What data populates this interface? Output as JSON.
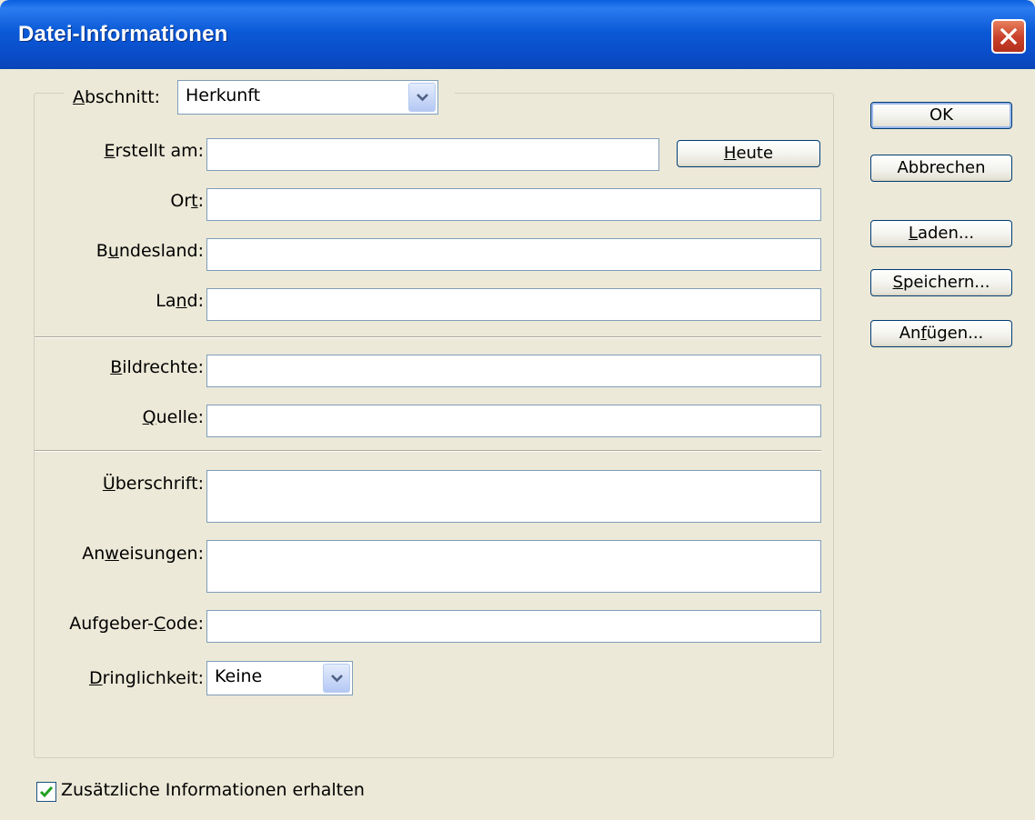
{
  "window": {
    "title": "Datei-Informationen",
    "close_icon": "close-icon"
  },
  "section": {
    "label_prefix": "A",
    "label_rest": "bschnitt:",
    "value": "Herkunft"
  },
  "fields": {
    "erstellt": {
      "label_u": "E",
      "label_rest": "rstellt am:",
      "value": ""
    },
    "ort": {
      "label_pre": "Or",
      "label_u": "t",
      "label_rest": ":",
      "value": ""
    },
    "bundesland": {
      "label_pre": "B",
      "label_u": "u",
      "label_rest": "ndesland:",
      "value": ""
    },
    "land": {
      "label_pre": "La",
      "label_u": "n",
      "label_rest": "d:",
      "value": ""
    },
    "bildrechte": {
      "label_u": "B",
      "label_rest": "ildrechte:",
      "value": ""
    },
    "quelle": {
      "label_u": "Q",
      "label_rest": "uelle:",
      "value": ""
    },
    "ueberschrift": {
      "label_u": "Ü",
      "label_rest": "berschrift:",
      "value": ""
    },
    "anweisungen": {
      "label_pre": "An",
      "label_u": "w",
      "label_rest": "eisungen:",
      "value": ""
    },
    "aufgeber": {
      "label_pre": "Aufgeber-",
      "label_u": "C",
      "label_rest": "ode:",
      "value": ""
    },
    "dringlichkeit": {
      "label_u": "D",
      "label_rest": "ringlichkeit:",
      "value": "Keine"
    }
  },
  "buttons": {
    "heute": {
      "u": "H",
      "rest": "eute"
    },
    "ok": {
      "label": "OK"
    },
    "abbrechen": {
      "label": "Abbrechen"
    },
    "laden": {
      "u": "L",
      "rest": "aden..."
    },
    "speichern": {
      "u": "S",
      "rest": "peichern..."
    },
    "anfuegen": {
      "pre": "An",
      "u": "f",
      "rest": "ügen..."
    }
  },
  "checkbox": {
    "label": "Zusätzliche Informationen erhalten",
    "checked": true
  },
  "colors": {
    "titlebar": "#0a5fe0",
    "dialog_bg": "#ece9d8",
    "close": "#c8402a",
    "check": "#21a121"
  }
}
